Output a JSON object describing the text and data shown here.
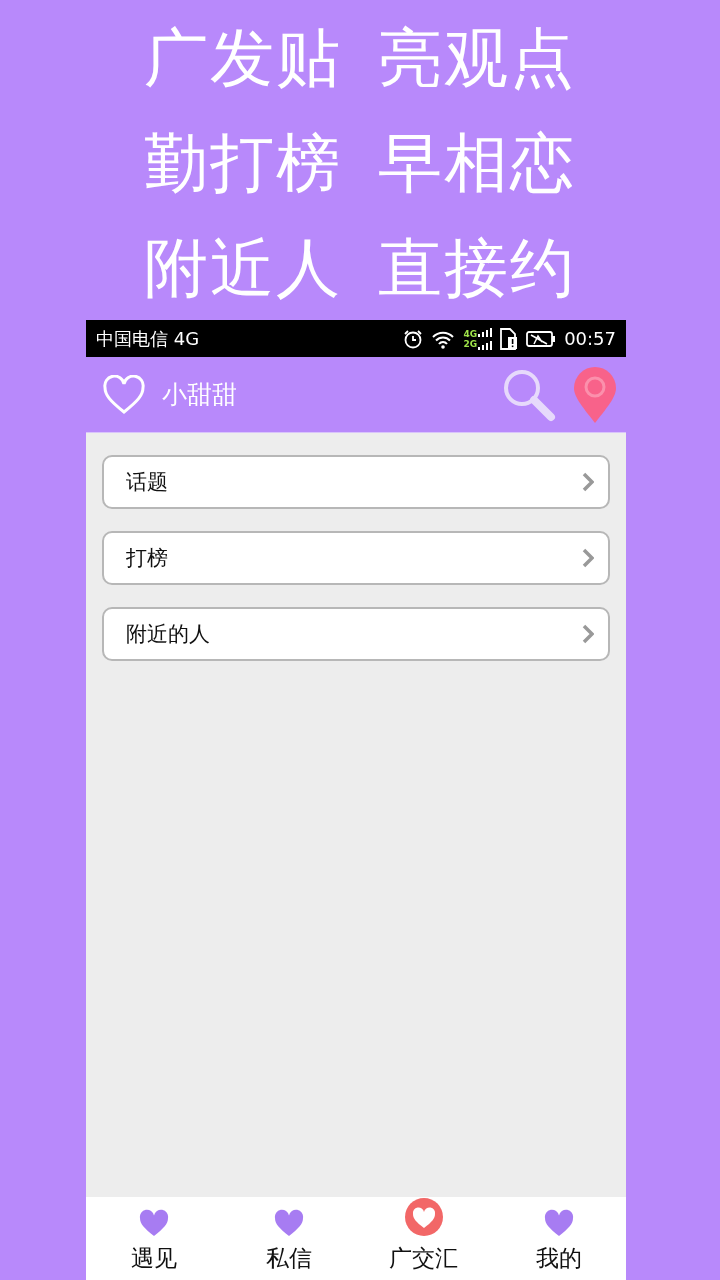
{
  "headline": [
    [
      "广发贴",
      "亮观点"
    ],
    [
      "勤打榜",
      "早相恋"
    ],
    [
      "附近人",
      "直接约"
    ]
  ],
  "status_bar": {
    "carrier": "中国电信 4G",
    "network_top": "4G",
    "network_bottom": "2G",
    "time": "00:57"
  },
  "app_bar": {
    "title": "小甜甜"
  },
  "menu": [
    {
      "label": "话题"
    },
    {
      "label": "打榜"
    },
    {
      "label": "附近的人"
    }
  ],
  "bottom_nav": [
    {
      "label": "遇见",
      "selected": false
    },
    {
      "label": "私信",
      "selected": false
    },
    {
      "label": "广交汇",
      "selected": true
    },
    {
      "label": "我的",
      "selected": false
    }
  ]
}
